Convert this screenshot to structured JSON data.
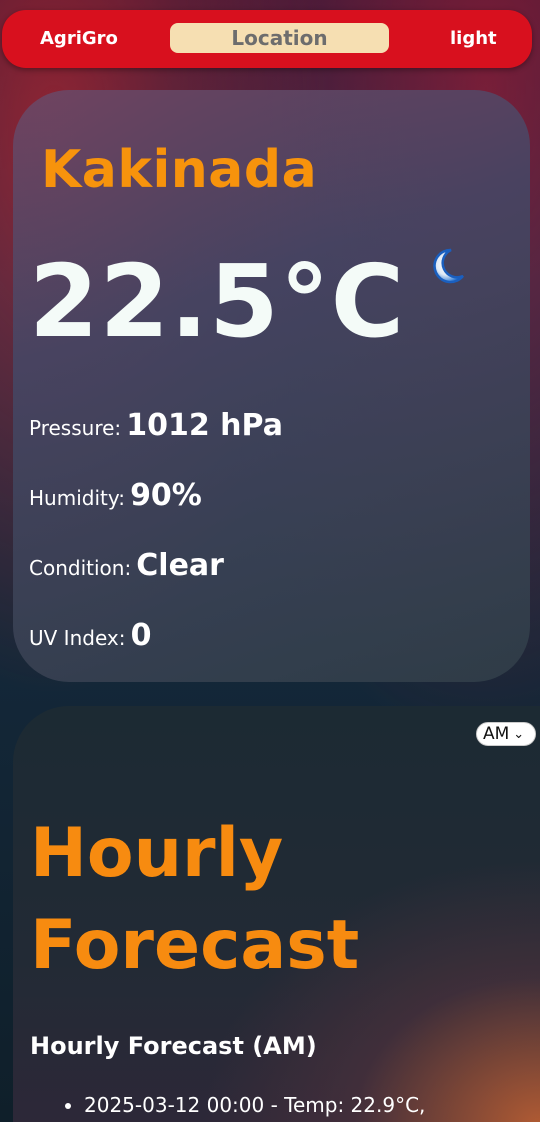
{
  "navbar": {
    "brand": "AgriGro",
    "location_button": "Location",
    "theme_toggle": "light"
  },
  "weather": {
    "city": "Kakinada",
    "temperature": "22.5°C",
    "condition_icon": "moon-icon",
    "pressure": {
      "label": "Pressure:",
      "value": "1012 hPa"
    },
    "humidity": {
      "label": "Humidity:",
      "value": "90%"
    },
    "condition": {
      "label": "Condition:",
      "value": "Clear"
    },
    "uv_index": {
      "label": "UV Index:",
      "value": "0"
    }
  },
  "forecast": {
    "period_select": "AM",
    "title_line1": "Hourly",
    "title_line2": "Forecast",
    "subtitle": "Hourly Forecast (AM)",
    "items": [
      "2025-03-12 00:00 - Temp: 22.9°C,"
    ]
  },
  "colors": {
    "nav_red": "#d8101e",
    "accent_orange": "#f7930c",
    "location_button_bg": "#f6dfb2",
    "moon_blue": "#1e6fd0"
  }
}
